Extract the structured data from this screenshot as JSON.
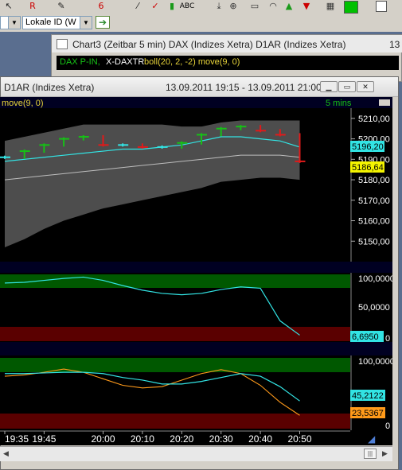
{
  "toolbar": {
    "icons": [
      "cursor-icon",
      "zoom-icon",
      "r-tool-icon",
      "fib-tool-icon",
      "pencil-icon",
      "flag-icon",
      "text-abc-icon",
      "crosshair-icon",
      "rectangle-icon",
      "arc-icon",
      "arrow-up-icon",
      "arrow-down-icon",
      "layout-icon",
      "color-swatch-icon",
      "square-icon"
    ],
    "abc_label": "ABC"
  },
  "toolbar2": {
    "combo1_value": "",
    "combo2_value": "Lokale ID (W",
    "go_button": "➔"
  },
  "chart3_window": {
    "title": "Chart3 (Zeitbar 5 min)  DAX (Indizes Xetra) D1AR (Indizes Xetra)",
    "edge_label": "13",
    "indicator_label_a": "DAX P-IN,",
    "indicator_label_b": "X-DAXTR",
    "indicator_label_c": "boll(20, 2, -2) move(9, 0)"
  },
  "main_window": {
    "title": "D1AR (Indizes Xetra)",
    "date_range": "13.09.2011 19:15 - 13.09.2011 21:00",
    "move_label": "move(9, 0)",
    "interval": "5 mins",
    "colors": {
      "up": "#16c016",
      "down": "#e01a1a",
      "neutral": "#32e4e4",
      "band": "#4d4d4d",
      "midline": "#bdbdbd",
      "green_zone": "#005800",
      "red_zone": "#5a0000",
      "orange": "#ff9a1a"
    }
  },
  "price_panel": {
    "y_ticks": [
      "5210,00",
      "5200,00",
      "5190,00",
      "5180,00",
      "5170,00",
      "5160,00",
      "5150,00"
    ],
    "badge_cyan": "5196,20",
    "badge_yellow": "5186,64"
  },
  "indicator1": {
    "y_ticks": [
      "100,0000",
      "50,0000",
      "0"
    ],
    "badge": "6,6950"
  },
  "indicator2": {
    "y_ticks": [
      "100,0000",
      "0"
    ],
    "badge_cyan": "45,2122",
    "badge_orange": "23,5367"
  },
  "time_axis": [
    "19:35",
    "19:45",
    "20:00",
    "20:10",
    "20:20",
    "20:30",
    "20:40",
    "20:50"
  ],
  "chart_data": {
    "type": "line",
    "x": [
      "19:35",
      "19:40",
      "19:45",
      "19:50",
      "19:55",
      "20:00",
      "20:05",
      "20:10",
      "20:15",
      "20:20",
      "20:25",
      "20:30",
      "20:35",
      "20:40",
      "20:45",
      "20:50"
    ],
    "series": [
      {
        "color": "#16c016",
        "bars_close": [
          5191,
          5194,
          5197,
          5200,
          5201,
          5197,
          5197,
          5196,
          5196,
          5198,
          5202,
          5205,
          5206,
          5204,
          5202,
          5189
        ]
      },
      {
        "color": "#32e4e4",
        "values": [
          5189,
          5190,
          5191,
          5192,
          5193,
          5194,
          5195,
          5195,
          5196,
          5197,
          5199,
          5201,
          5201,
          5200,
          5199,
          5196
        ]
      },
      {
        "color": "#bdbdbd",
        "values": [
          5180,
          5181,
          5182,
          5183,
          5184,
          5185,
          5186,
          5187,
          5188,
          5189,
          5190,
          5191,
          5192,
          5192,
          5192,
          5191
        ]
      }
    ],
    "ylim": [
      5140,
      5215
    ]
  }
}
